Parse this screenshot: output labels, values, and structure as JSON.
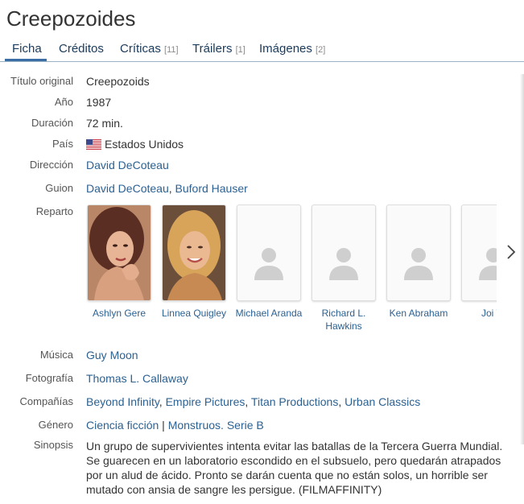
{
  "title": "Creepozoides",
  "tabs": [
    {
      "label": "Ficha",
      "count": ""
    },
    {
      "label": "Créditos",
      "count": ""
    },
    {
      "label": "Críticas",
      "count": "[11]"
    },
    {
      "label": "Tráilers",
      "count": "[1]"
    },
    {
      "label": "Imágenes",
      "count": "[2]"
    }
  ],
  "details": {
    "original_title_label": "Título original",
    "original_title": "Creepozoids",
    "year_label": "Año",
    "year": "1987",
    "duration_label": "Duración",
    "duration": "72 min.",
    "country_label": "País",
    "country": "Estados Unidos",
    "country_flag_icon": "us-flag-icon",
    "director_label": "Dirección",
    "director": "David DeCoteau",
    "writers_label": "Guion",
    "writers": [
      "David DeCoteau",
      "Buford Hauser"
    ],
    "cast_label": "Reparto",
    "cast": [
      {
        "name": "Ashlyn Gere",
        "photo": "portrait"
      },
      {
        "name": "Linnea Quigley",
        "photo": "portrait"
      },
      {
        "name": "Michael Aranda",
        "photo": "placeholder"
      },
      {
        "name": "Richard L. Hawkins",
        "photo": "placeholder"
      },
      {
        "name": "Ken Abraham",
        "photo": "placeholder"
      },
      {
        "name": "Joi W",
        "photo": "placeholder"
      }
    ],
    "music_label": "Música",
    "music": "Guy Moon",
    "photography_label": "Fotografía",
    "photography": "Thomas L. Callaway",
    "companies_label": "Compañías",
    "companies": [
      "Beyond Infinity",
      "Empire Pictures",
      "Titan Productions",
      "Urban Classics"
    ],
    "genre_label": "Género",
    "genres": [
      "Ciencia ficción",
      "Monstruos. Serie B"
    ],
    "synopsis_label": "Sinopsis",
    "synopsis": "Un grupo de supervivientes intenta evitar las batallas de la Tercera Guerra Mundial. Se guarecen en un laboratorio escondido en el subsuelo, pero quedarán atrapados por un alud de ácido. Pronto se darán cuenta que no están solos, un horrible ser mutado con ansia de sangre les persigue. (FILMAFFINITY)"
  },
  "colors": {
    "link": "#2c6192",
    "tab_underline": "#3a6ea5",
    "divider": "#9ab2c8"
  }
}
